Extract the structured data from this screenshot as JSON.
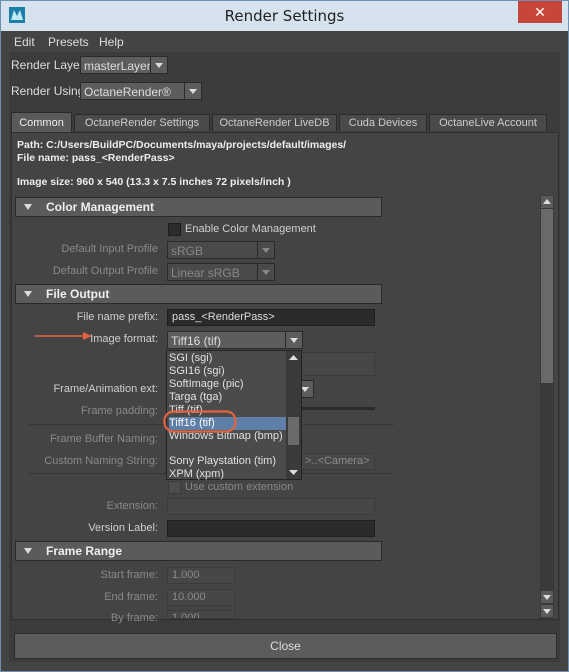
{
  "window": {
    "title": "Render Settings",
    "close_glyph": "✕",
    "frame_color": "#6f8fb1",
    "close_color": "#c7463a"
  },
  "menu": [
    "Edit",
    "Presets",
    "Help"
  ],
  "render_layer": {
    "label": "Render Layer",
    "value": "masterLayer"
  },
  "render_using": {
    "label": "Render Using",
    "value": "OctaneRender®"
  },
  "tabs": [
    "Common",
    "OctaneRender Settings",
    "OctaneRender LiveDB",
    "Cuda Devices",
    "OctaneLive Account"
  ],
  "active_tab": "Common",
  "paths": {
    "path": "Path: C:/Users/BuildPC/Documents/maya/projects/default/images/",
    "file_name": "File name:  pass_<RenderPass>",
    "image_size": "Image size: 960 x 540 (13.3 x 7.5 inches 72 pixels/inch )"
  },
  "color_management": {
    "title": "Color Management",
    "enable_label": "Enable Color Management",
    "input_profile_label": "Default Input Profile",
    "input_profile_value": "sRGB",
    "output_profile_label": "Default Output Profile",
    "output_profile_value": "Linear sRGB"
  },
  "file_output": {
    "title": "File Output",
    "prefix_label": "File name prefix:",
    "prefix_value": "pass_<RenderPass>",
    "format_label": "Image format:",
    "format_value": "Tiff16 (tif)",
    "frame_ext_label": "Frame/Animation ext:",
    "frame_padding_label": "Frame padding:",
    "frame_buffer_label": "Frame Buffer Naming:",
    "custom_naming_label": "Custom Naming String:",
    "custom_naming_value": ">..<Camera>",
    "use_custom_ext_label": "Use custom extension",
    "extension_label": "Extension:",
    "version_label": "Version Label:"
  },
  "format_options": [
    "SGI (sgi)",
    "SGI16 (sgi)",
    "SoftImage (pic)",
    "Targa (tga)",
    "Tiff (tif)",
    "Tiff16 (tif)",
    "Windows Bitmap (bmp)",
    "",
    "Sony Playstation (tim)",
    "XPM (xpm)"
  ],
  "frame_range": {
    "title": "Frame Range",
    "start_label": "Start frame:",
    "start_value": "1.000",
    "end_label": "End frame:",
    "end_value": "10.000",
    "by_label": "By frame:",
    "by_value": "1.000"
  },
  "close_button": "Close",
  "annotation_color": "#e0653f"
}
